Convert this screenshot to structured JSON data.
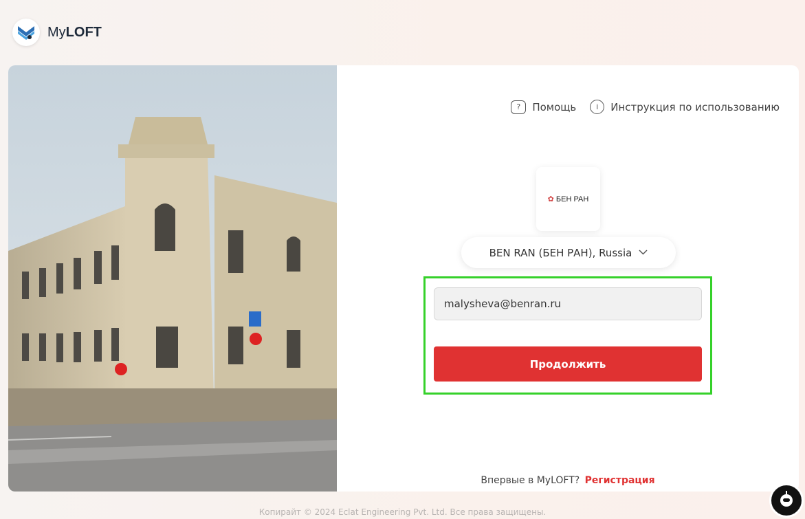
{
  "brand": {
    "name_prefix": "My",
    "name_bold": "LOFT"
  },
  "help": {
    "help_label": "Помощь",
    "manual_label": "Инструкция по использованию",
    "help_icon_glyph": "?",
    "info_icon_glyph": "i"
  },
  "organization": {
    "logo_text": "БЕН РАН",
    "selected": "BEN RAN (БЕН РАН), Russia"
  },
  "login": {
    "email_value": "malysheva@benran.ru",
    "continue_label": "Продолжить"
  },
  "signup": {
    "prompt": "Впервые в MyLOFT?",
    "link_label": "Регистрация"
  },
  "footer": {
    "copyright": "Копирайт © 2024 Eclat Engineering Pvt. Ltd. Все права защищены."
  },
  "colors": {
    "accent": "#e03232",
    "highlight": "#35d12a",
    "brand_blue": "#2c6fb5"
  }
}
